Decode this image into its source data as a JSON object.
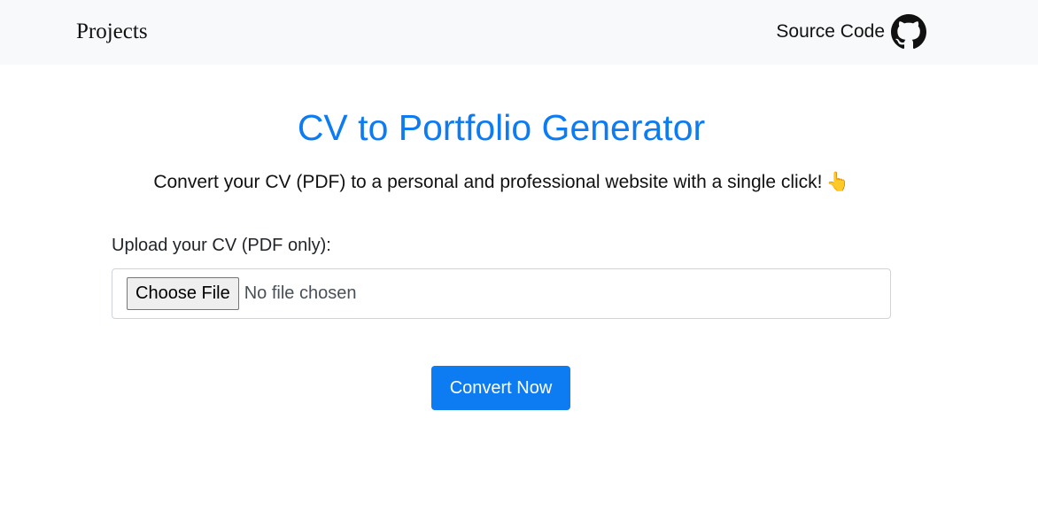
{
  "navbar": {
    "brand": "Projects",
    "source_label": "Source Code",
    "source_icon": "github-icon"
  },
  "main": {
    "title": "CV to Portfolio Generator",
    "subtitle": "Convert your CV (PDF) to a personal and professional website with a single click!",
    "subtitle_emoji": "👆",
    "upload_label": "Upload your CV (PDF only):",
    "choose_file_label": "Choose File",
    "file_status": "No file chosen",
    "convert_label": "Convert Now"
  },
  "colors": {
    "accent": "#0d7bf1",
    "navbar_bg": "#f8f9fa"
  }
}
